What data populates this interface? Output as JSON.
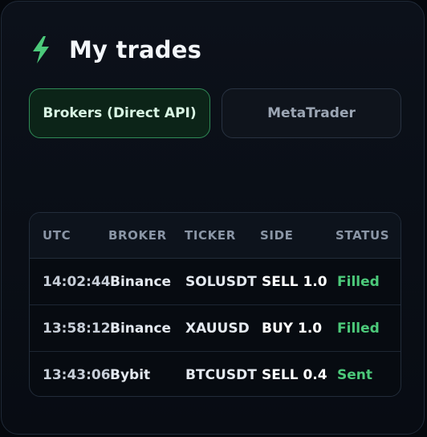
{
  "header": {
    "icon": "lightning-bolt-icon",
    "title": "My trades"
  },
  "tabs": [
    {
      "label": "Brokers (Direct API)",
      "active": true
    },
    {
      "label": "MetaTrader",
      "active": false
    }
  ],
  "table": {
    "columns": [
      "UTC",
      "BROKER",
      "TICKER",
      "SIDE",
      "STATUS"
    ],
    "rows": [
      {
        "utc": "14:02:44",
        "broker": "Binance",
        "ticker": "SOLUSDT",
        "side": "SELL 1.0",
        "status": "Filled"
      },
      {
        "utc": "13:58:12",
        "broker": "Binance",
        "ticker": "XAUUSD",
        "side": "BUY 1.0",
        "status": "Filled"
      },
      {
        "utc": "13:43:06",
        "broker": "Bybit",
        "ticker": "BTCUSDT",
        "side": "SELL 0.4",
        "status": "Sent"
      }
    ]
  },
  "colors": {
    "accent_green": "#4cc97a",
    "background": "#05080d"
  }
}
